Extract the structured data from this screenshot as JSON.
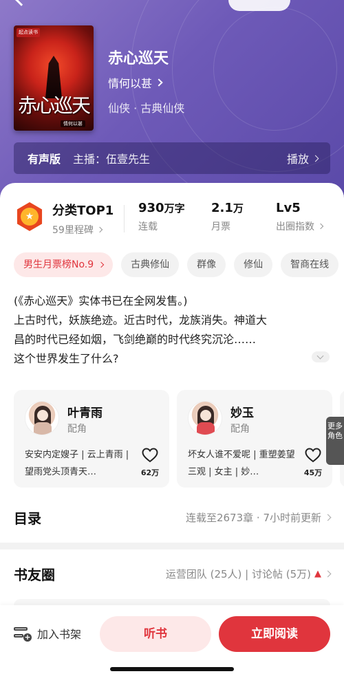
{
  "book": {
    "title": "赤心巡天",
    "author": "情何以甚",
    "genre": "仙侠 · 古典仙侠",
    "cover": {
      "badge": "起点读书",
      "title_art": "赤心巡天",
      "author_art": "情何以甚"
    }
  },
  "audio": {
    "label": "有声版",
    "host": "主播：伍壹先生",
    "play": "播放"
  },
  "stats": [
    {
      "value": "分类TOP1",
      "unit": "",
      "label": "59里程碑",
      "has_chevron": true
    },
    {
      "value": "930",
      "unit": "万字",
      "label": "连载",
      "has_chevron": false
    },
    {
      "value": "2.1",
      "unit": "万",
      "label": "月票",
      "has_chevron": false
    },
    {
      "value": "Lv5",
      "unit": "",
      "label": "出圈指数",
      "has_chevron": true
    }
  ],
  "tags": [
    "男生月票榜No.9",
    "古典修仙",
    "群像",
    "修仙",
    "智商在线"
  ],
  "description": [
    "(《赤心巡天》实体书已在全网发售。)",
    "上古时代，妖族绝迹。近古时代，龙族消失。神道大",
    "昌的时代已经如烟，飞剑绝巅的时代终究沉沦……",
    "这个世界发生了什么?"
  ],
  "characters": [
    {
      "name": "叶青雨",
      "role": "配角",
      "blurb": "安安内定嫂子 | 云上青雨 | 望雨党头顶青天…",
      "likes": "62万",
      "avatar_style": "neutral"
    },
    {
      "name": "妙玉",
      "role": "配角",
      "blurb": "坏女人谁不爱呢 | 重塑姜望三观 | 女主 | 妙…",
      "likes": "45万",
      "avatar_style": "red"
    }
  ],
  "more_characters": "更多角色",
  "catalog": {
    "heading": "目录",
    "info": "连载至2673章 · 7小时前更新"
  },
  "community": {
    "heading": "书友圈",
    "info": "运营团队 (25人) | 讨论帖 (5万)"
  },
  "bottom": {
    "shelf": "加入书架",
    "listen": "听书",
    "read": "立即阅读"
  },
  "colors": {
    "accent": "#e0353d",
    "header_purple": "#6e5ab8"
  },
  "icons": {
    "back": "back-arrow-icon",
    "medal": "medal-icon",
    "heart": "heart-icon",
    "flame": "flame-icon",
    "shelf": "bookshelf-add-icon"
  }
}
